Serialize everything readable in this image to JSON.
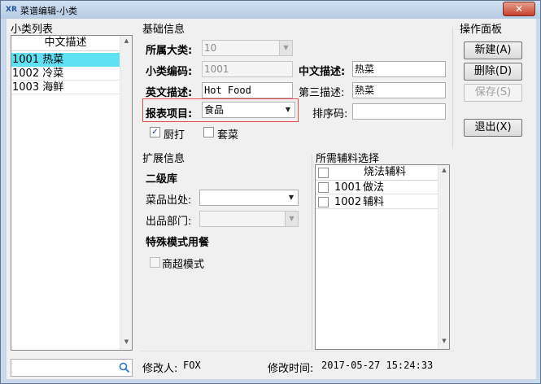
{
  "window": {
    "title": "菜谱编辑-小类",
    "logo": "XR",
    "close_label": "✕"
  },
  "left_panel": {
    "title": "小类列表",
    "column_header": "中文描述",
    "rows": [
      "1001 热菜",
      "1002 冷菜",
      "1003 海鲜"
    ],
    "search_value": ""
  },
  "basic_info": {
    "title": "基础信息",
    "category_label": "所属大类:",
    "category_value": "10",
    "subclass_code_label": "小类编码:",
    "subclass_code_value": "1001",
    "cn_desc_label": "中文描述:",
    "cn_desc_value": "热菜",
    "en_desc_label": "英文描述:",
    "en_desc_value": "Hot Food",
    "third_desc_label": "第三描述:",
    "third_desc_value": "熱菜",
    "report_item_label": "报表项目:",
    "report_item_value": "食品",
    "sort_code_label": "排序码:",
    "sort_code_value": "",
    "kitchen_print_label": "厨打",
    "kitchen_print_checked": true,
    "set_meal_label": "套菜",
    "set_meal_checked": false
  },
  "extended_info": {
    "title": "扩展信息",
    "level2_title": "二级库",
    "origin_label": "菜品出处:",
    "origin_value": "",
    "dept_label": "出品部门:",
    "dept_value": "",
    "special_mode_title": "特殊模式用餐",
    "supermarket_label": "商超模式",
    "supermarket_checked": false
  },
  "accessories": {
    "title": "所需辅料选择",
    "column_header": "烧法辅料",
    "rows": [
      {
        "code": "1001",
        "name": "做法"
      },
      {
        "code": "1002",
        "name": "辅料"
      }
    ]
  },
  "operation_panel": {
    "title": "操作面板",
    "new_label": "新建(A)",
    "delete_label": "删除(D)",
    "save_label": "保存(S)",
    "exit_label": "退出(X)"
  },
  "footer": {
    "modifier_label": "修改人:",
    "modifier_value": "FOX",
    "modified_time_label": "修改时间:",
    "modified_time_value": "2017-05-27 15:24:33"
  },
  "colors": {
    "selected_row": "#5fe1f3",
    "highlight_border": "#e84b4b"
  }
}
